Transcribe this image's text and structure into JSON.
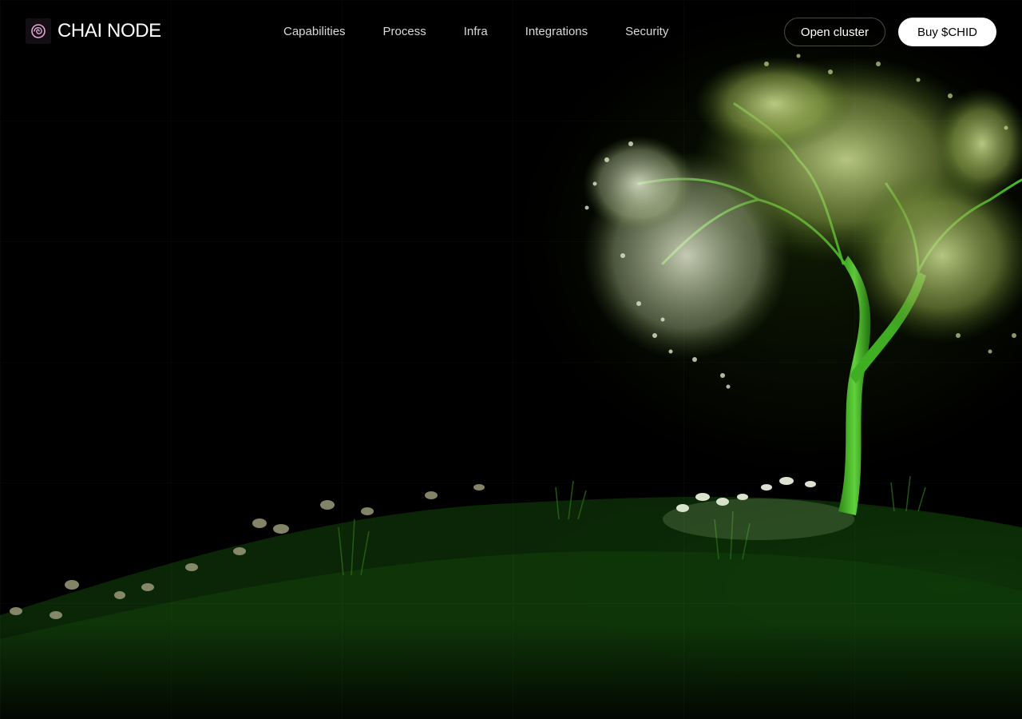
{
  "brand": {
    "name": "CHAI NODE",
    "logo_icon": "swirl-logo-icon",
    "logo_color": "#e7a6d8"
  },
  "nav": {
    "items": [
      {
        "label": "Capabilities"
      },
      {
        "label": "Process"
      },
      {
        "label": "Infra"
      },
      {
        "label": "Integrations"
      },
      {
        "label": "Security"
      }
    ]
  },
  "actions": {
    "open_cluster_label": "Open cluster",
    "buy_label": "Buy $CHID"
  },
  "hero": {
    "image_icon": "glowing-tree-illustration",
    "accent": "#4aa02c"
  }
}
